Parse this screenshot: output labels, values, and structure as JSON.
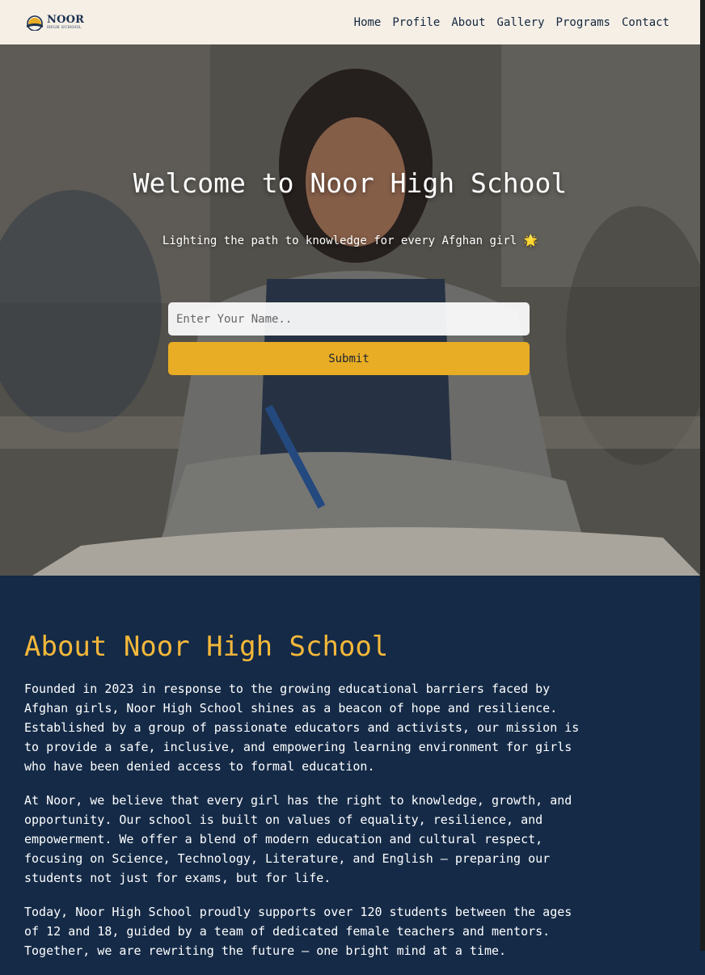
{
  "brand": {
    "name": "NOOR",
    "tagline": "HIGH SCHOOL"
  },
  "nav": {
    "items": [
      {
        "label": "Home"
      },
      {
        "label": "Profile"
      },
      {
        "label": "About"
      },
      {
        "label": "Gallery"
      },
      {
        "label": "Programs"
      },
      {
        "label": "Contact"
      }
    ]
  },
  "hero": {
    "title": "Welcome to Noor High School",
    "subtitle": "Lighting the path to knowledge for every Afghan girl 🌟",
    "input_placeholder": "Enter Your Name..",
    "submit_label": "Submit"
  },
  "about": {
    "title": "About Noor High School",
    "paragraphs": [
      "Founded in 2023 in response to the growing educational barriers faced by Afghan girls, Noor High School shines as a beacon of hope and resilience. Established by a group of passionate educators and activists, our mission is to provide a safe, inclusive, and empowering learning environment for girls who have been denied access to formal education.",
      "At Noor, we believe that every girl has the right to knowledge, growth, and opportunity. Our school is built on values of equality, resilience, and empowerment. We offer a blend of modern education and cultural respect, focusing on Science, Technology, Literature, and English — preparing our students not just for exams, but for life.",
      "Today, Noor High School proudly supports over 120 students between the ages of 12 and 18, guided by a team of dedicated female teachers and mentors. Together, we are rewriting the future — one bright mind at a time."
    ]
  },
  "colors": {
    "navbar_bg": "#f5efe6",
    "accent_gold": "#e8ad24",
    "heading_gold": "#f4b83a",
    "section_navy": "#142a47"
  }
}
